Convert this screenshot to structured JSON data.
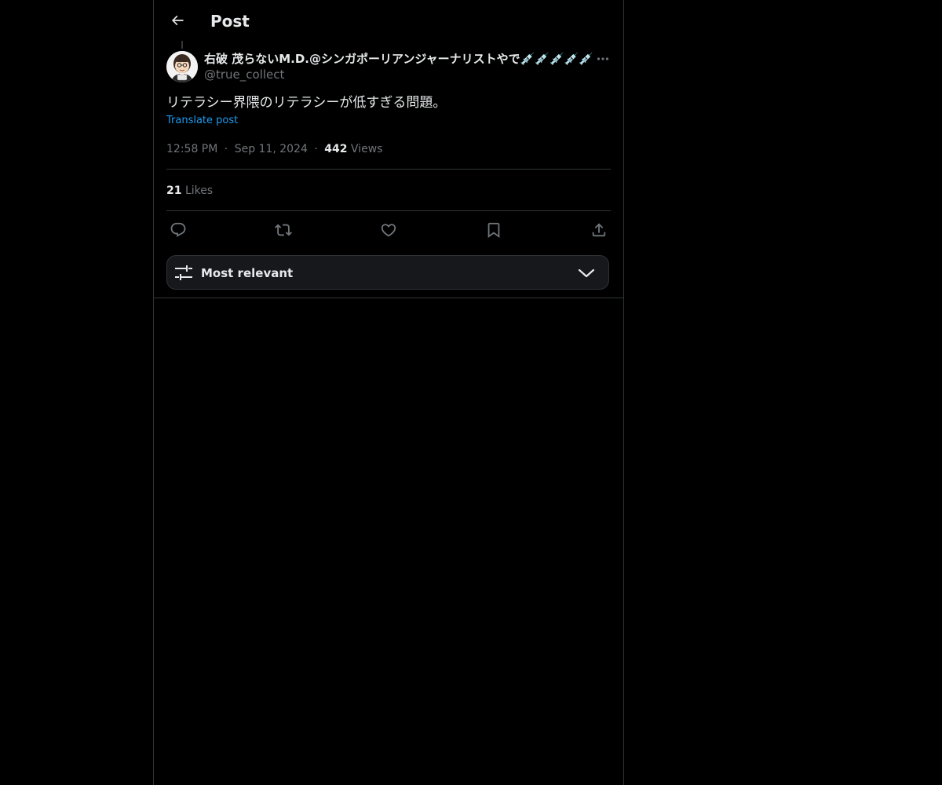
{
  "header": {
    "title": "Post",
    "back_icon": "arrow-left-icon"
  },
  "post": {
    "author_name": "右破 茂らないM.D.@シンガポーリアンジャーナリストやで💉💉💉💉💉",
    "author_handle": "@true_collect",
    "text": "リテラシー界隈のリテラシーが低すぎる問題。",
    "translate_label": "Translate post",
    "time": "12:58 PM",
    "date": "Sep 11, 2024",
    "separator": "·",
    "views_count": "442",
    "views_label": "Views",
    "likes_count": "21",
    "likes_label": "Likes"
  },
  "actions": {
    "icons": [
      "reply-icon",
      "repost-icon",
      "like-icon",
      "bookmark-icon",
      "share-icon"
    ]
  },
  "sort": {
    "label": "Most relevant",
    "icon": "sliders-icon",
    "chevron": "chevron-down-icon"
  },
  "colors": {
    "background": "#000000",
    "text": "#e7e9ea",
    "muted": "#71767b",
    "accent": "#1d9bf0",
    "border": "#2f3336"
  }
}
